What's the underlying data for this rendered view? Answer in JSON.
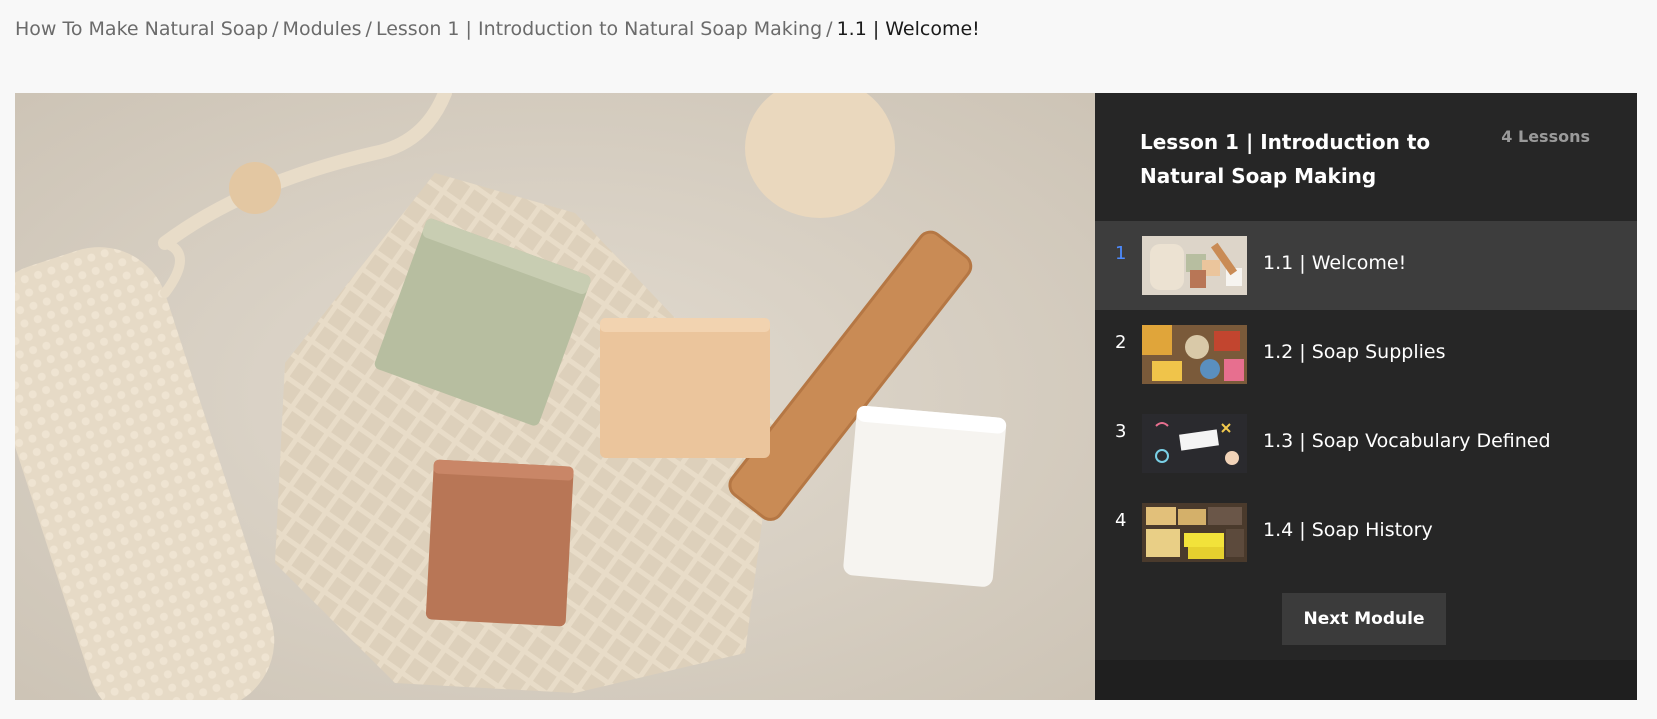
{
  "breadcrumb": {
    "items": [
      "How To Make Natural Soap",
      "Modules",
      "Lesson 1 | Introduction to Natural Soap Making"
    ],
    "current": "1.1 | Welcome!",
    "separator": "/"
  },
  "hero": {
    "image_icon": "soap-bars-photo"
  },
  "module": {
    "title": "Lesson 1 | Introduction to Natural Soap Making",
    "lesson_count": "4 Lessons",
    "lessons": [
      {
        "number": "1",
        "title": "1.1 | Welcome!",
        "active": true
      },
      {
        "number": "2",
        "title": "1.2 | Soap Supplies",
        "active": false
      },
      {
        "number": "3",
        "title": "1.3 | Soap Vocabulary Defined",
        "active": false
      },
      {
        "number": "4",
        "title": "1.4 | Soap History",
        "active": false
      }
    ],
    "next_label": "Next Module"
  },
  "colors": {
    "panel_bg": "#262626",
    "active_row": "#3d3d3d",
    "active_number": "#4d8bff"
  }
}
